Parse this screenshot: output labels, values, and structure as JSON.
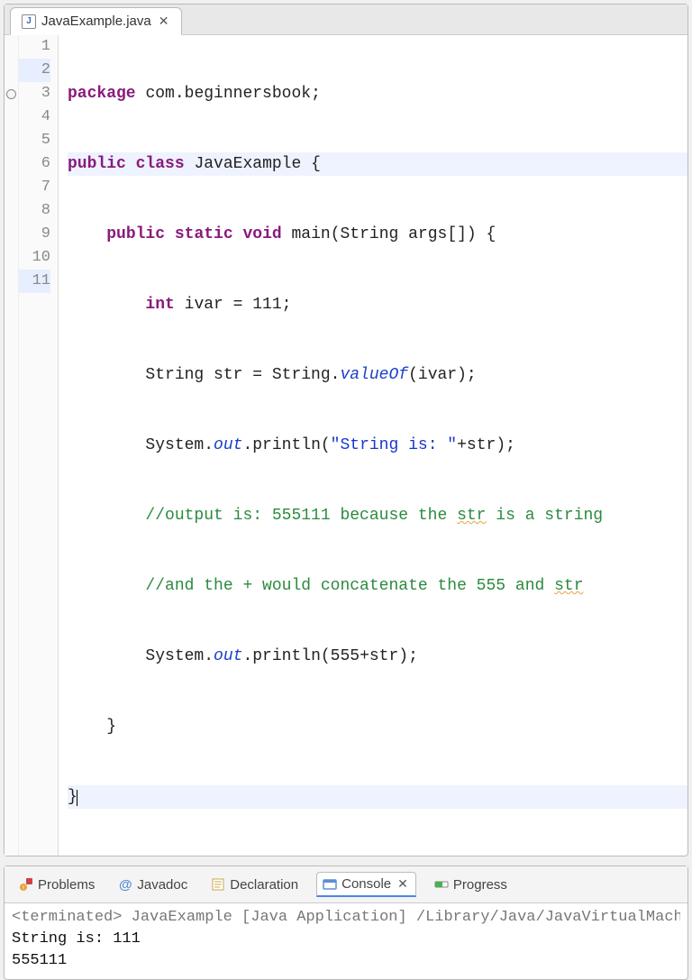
{
  "editor": {
    "tab": {
      "filename": "JavaExample.java",
      "icon": "J"
    },
    "lines": [
      {
        "n": 1,
        "marker": "",
        "hl": false
      },
      {
        "n": 2,
        "marker": "",
        "hl": true
      },
      {
        "n": 3,
        "marker": "fold",
        "hl": false
      },
      {
        "n": 4,
        "marker": "",
        "hl": false
      },
      {
        "n": 5,
        "marker": "",
        "hl": false
      },
      {
        "n": 6,
        "marker": "",
        "hl": false
      },
      {
        "n": 7,
        "marker": "",
        "hl": false
      },
      {
        "n": 8,
        "marker": "",
        "hl": false
      },
      {
        "n": 9,
        "marker": "",
        "hl": false
      },
      {
        "n": 10,
        "marker": "",
        "hl": false
      },
      {
        "n": 11,
        "marker": "",
        "hl": true
      }
    ],
    "code": {
      "l1": {
        "kw_package": "package",
        "pkg": "com.beginnersbook;"
      },
      "l2": {
        "kw_public": "public",
        "kw_class": "class",
        "name": "JavaExample",
        "brace": "{"
      },
      "l3": {
        "indent": "    ",
        "kw_public": "public",
        "kw_static": "static",
        "kw_void": "void",
        "main": "main(String args[]) {"
      },
      "l4": {
        "indent": "        ",
        "kw_int": "int",
        "rest": "ivar = 111;"
      },
      "l5": {
        "indent": "        ",
        "a": "String str = String.",
        "it": "valueOf",
        "b": "(ivar);"
      },
      "l6": {
        "indent": "        ",
        "a": "System.",
        "it": "out",
        "b": ".println(",
        "str": "\"String is: \"",
        "c": "+str);"
      },
      "l7": {
        "indent": "        ",
        "a": "//output is: 555111 because the ",
        "sq": "str",
        "b": " is a string"
      },
      "l8": {
        "indent": "        ",
        "a": "//and the + would concatenate the 555 and ",
        "sq": "str"
      },
      "l9": {
        "indent": "        ",
        "a": "System.",
        "it": "out",
        "b": ".println(555+str);"
      },
      "l10": {
        "indent": "    ",
        "brace": "}"
      },
      "l11": {
        "brace": "}"
      }
    }
  },
  "views": {
    "problems": "Problems",
    "javadoc": "Javadoc",
    "declaration": "Declaration",
    "console": "Console",
    "progress": "Progress",
    "javadoc_at": "@"
  },
  "console": {
    "header": "<terminated> JavaExample [Java Application] /Library/Java/JavaVirtualMachines",
    "out1": "String is: 111",
    "out2": "555111"
  }
}
